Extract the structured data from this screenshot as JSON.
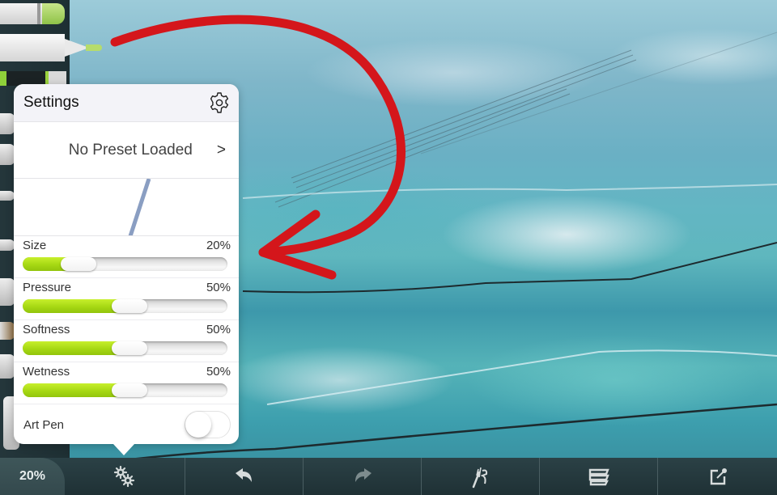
{
  "canvas": {
    "annotation_arrow_color": "#d4161b"
  },
  "tool_rail": {
    "tools": [
      "marker",
      "fine-pen",
      "pencil",
      "roller",
      "palette-knife",
      "airbrush",
      "oil-brush",
      "eraser",
      "fill"
    ]
  },
  "settings_panel": {
    "title": "Settings",
    "gear_icon": "gear-icon",
    "preset": {
      "label": "No Preset Loaded",
      "chevron": ">"
    },
    "accent_color": "#a6d813",
    "sliders": [
      {
        "label": "Size",
        "value_text": "20%",
        "value": 20
      },
      {
        "label": "Pressure",
        "value_text": "50%",
        "value": 50
      },
      {
        "label": "Softness",
        "value_text": "50%",
        "value": 50
      },
      {
        "label": "Wetness",
        "value_text": "50%",
        "value": 50
      }
    ],
    "art_pen": {
      "label": "Art Pen",
      "enabled": false
    }
  },
  "toolbar": {
    "zoom_label": "20%",
    "items": [
      {
        "name": "tool-settings",
        "icon": "gears-icon"
      },
      {
        "name": "undo",
        "icon": "undo-icon"
      },
      {
        "name": "redo",
        "icon": "redo-icon"
      },
      {
        "name": "brush-tools",
        "icon": "brush-icon"
      },
      {
        "name": "layers",
        "icon": "layers-icon"
      },
      {
        "name": "export",
        "icon": "export-icon"
      }
    ]
  }
}
